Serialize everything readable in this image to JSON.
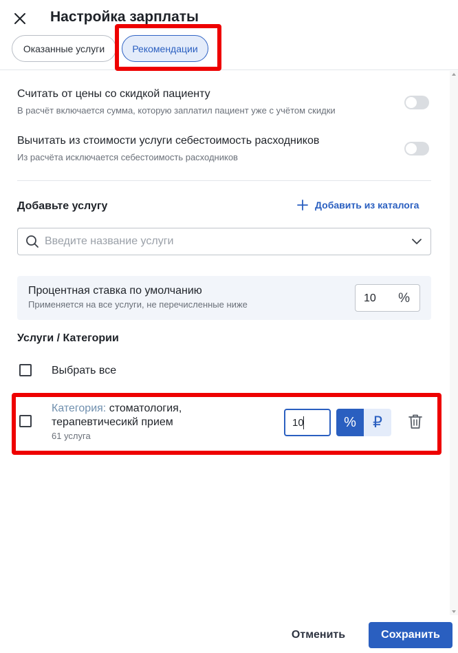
{
  "header": {
    "title": "Настройка зарплаты",
    "close_icon": "close-icon",
    "tabs": [
      {
        "label": "Оказанные услуги",
        "active": false
      },
      {
        "label": "Рекомендации",
        "active": true
      }
    ]
  },
  "options": [
    {
      "title": "Считать от цены со скидкой пациенту",
      "description": "В расчёт включается сумма, которую заплатил пациент уже с учётом скидки",
      "enabled": false
    },
    {
      "title": "Вычитать из стоимости услуги себестоимость расходников",
      "description": "Из расчёта исключается себестоимость расходников",
      "enabled": false
    }
  ],
  "add_service": {
    "title": "Добавьте услугу",
    "catalog_link": "Добавить из каталога",
    "search_placeholder": "Введите название услуги",
    "search_value": ""
  },
  "default_rate": {
    "title": "Процентная ставка по умолчанию",
    "description": "Применяется на все услуги, не перечисленные ниже",
    "value": "10",
    "unit": "%"
  },
  "services": {
    "title": "Услуги / Категории",
    "select_all": "Выбрать все",
    "items": [
      {
        "prefix": "Категория:",
        "name_line1": "стоматология,",
        "name_line2": "терапевтичесикй прием",
        "count": "61 услуга",
        "rate": "10",
        "unit_percent": "%",
        "unit_rub": "₽",
        "selected_unit": "%"
      }
    ]
  },
  "footer": {
    "cancel": "Отменить",
    "save": "Сохранить"
  },
  "colors": {
    "accent": "#2a5fc0",
    "highlight": "#ee0000"
  }
}
